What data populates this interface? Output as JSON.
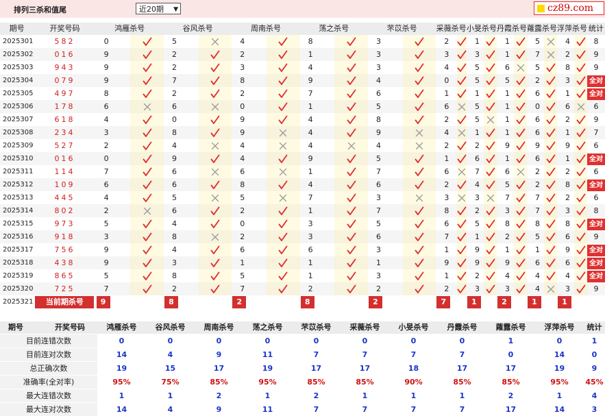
{
  "header": {
    "title": "排列三杀和值尾",
    "select_value": "近20期",
    "logo_text": "cz89.com"
  },
  "columns": {
    "period": "期号",
    "draw": "开奖号码",
    "experts": [
      "鸿雁杀号",
      "谷风杀号",
      "周南杀号",
      "荡之杀号",
      "芣苡杀号",
      "采薇杀号",
      "小旻杀号",
      "丹霞杀号",
      "蕹露杀号",
      "浮萍杀号"
    ],
    "stat": "统计"
  },
  "all_right_label": "全对",
  "current_label": "当前期杀号",
  "current_period": "2025321",
  "current_predictions": [
    "9",
    "8",
    "2",
    "8",
    "2",
    "7",
    "1",
    "2",
    "1",
    "1"
  ],
  "rows": [
    {
      "period": "2025301",
      "draw": "582",
      "kills": [
        "0",
        "5",
        "4",
        "8",
        "3",
        "2",
        "1",
        "1",
        "5",
        "4"
      ],
      "marks": [
        1,
        0,
        1,
        1,
        1,
        1,
        1,
        1,
        0,
        1
      ],
      "stat": "8"
    },
    {
      "period": "2025302",
      "draw": "016",
      "kills": [
        "9",
        "2",
        "2",
        "1",
        "3",
        "3",
        "3",
        "1",
        "7",
        "2"
      ],
      "marks": [
        1,
        1,
        1,
        1,
        1,
        1,
        1,
        1,
        0,
        1
      ],
      "stat": "9"
    },
    {
      "period": "2025303",
      "draw": "943",
      "kills": [
        "9",
        "2",
        "3",
        "4",
        "3",
        "4",
        "5",
        "6",
        "5",
        "8"
      ],
      "marks": [
        1,
        1,
        1,
        1,
        1,
        1,
        1,
        0,
        1,
        1
      ],
      "stat": "9"
    },
    {
      "period": "2025304",
      "draw": "079",
      "kills": [
        "9",
        "7",
        "8",
        "9",
        "4",
        "0",
        "5",
        "5",
        "2",
        "3"
      ],
      "marks": [
        1,
        1,
        1,
        1,
        1,
        1,
        1,
        1,
        1,
        1
      ],
      "stat": "全对"
    },
    {
      "period": "2025305",
      "draw": "497",
      "kills": [
        "8",
        "2",
        "2",
        "7",
        "6",
        "1",
        "1",
        "1",
        "6",
        "1"
      ],
      "marks": [
        1,
        1,
        1,
        1,
        1,
        1,
        1,
        1,
        1,
        1
      ],
      "stat": "全对"
    },
    {
      "period": "2025306",
      "draw": "178",
      "kills": [
        "6",
        "6",
        "0",
        "1",
        "5",
        "6",
        "5",
        "1",
        "0",
        "6"
      ],
      "marks": [
        0,
        0,
        1,
        1,
        1,
        0,
        1,
        1,
        1,
        0
      ],
      "stat": "6"
    },
    {
      "period": "2025307",
      "draw": "618",
      "kills": [
        "4",
        "0",
        "9",
        "4",
        "8",
        "2",
        "5",
        "1",
        "6",
        "2"
      ],
      "marks": [
        1,
        1,
        1,
        1,
        1,
        1,
        0,
        1,
        1,
        1
      ],
      "stat": "9"
    },
    {
      "period": "2025308",
      "draw": "234",
      "kills": [
        "3",
        "8",
        "9",
        "4",
        "9",
        "4",
        "1",
        "1",
        "6",
        "1"
      ],
      "marks": [
        1,
        1,
        0,
        1,
        0,
        0,
        1,
        1,
        1,
        1
      ],
      "stat": "7"
    },
    {
      "period": "2025309",
      "draw": "527",
      "kills": [
        "2",
        "4",
        "4",
        "4",
        "4",
        "2",
        "2",
        "9",
        "9",
        "9"
      ],
      "marks": [
        1,
        0,
        0,
        0,
        0,
        1,
        1,
        1,
        1,
        1
      ],
      "stat": "6"
    },
    {
      "period": "2025310",
      "draw": "016",
      "kills": [
        "0",
        "9",
        "4",
        "9",
        "5",
        "1",
        "6",
        "1",
        "6",
        "1"
      ],
      "marks": [
        1,
        1,
        1,
        1,
        1,
        1,
        1,
        1,
        1,
        1
      ],
      "stat": "全对"
    },
    {
      "period": "2025311",
      "draw": "114",
      "kills": [
        "7",
        "6",
        "6",
        "1",
        "7",
        "6",
        "7",
        "6",
        "2",
        "2"
      ],
      "marks": [
        1,
        0,
        0,
        1,
        1,
        0,
        1,
        0,
        1,
        1
      ],
      "stat": "6"
    },
    {
      "period": "2025312",
      "draw": "109",
      "kills": [
        "6",
        "6",
        "8",
        "4",
        "6",
        "2",
        "4",
        "5",
        "2",
        "8"
      ],
      "marks": [
        1,
        1,
        1,
        1,
        1,
        1,
        1,
        1,
        1,
        1
      ],
      "stat": "全对"
    },
    {
      "period": "2025313",
      "draw": "445",
      "kills": [
        "4",
        "5",
        "5",
        "7",
        "3",
        "3",
        "3",
        "7",
        "7",
        "2"
      ],
      "marks": [
        1,
        0,
        0,
        1,
        0,
        0,
        0,
        1,
        1,
        1
      ],
      "stat": "6"
    },
    {
      "period": "2025314",
      "draw": "802",
      "kills": [
        "2",
        "6",
        "2",
        "1",
        "7",
        "8",
        "2",
        "3",
        "7",
        "3"
      ],
      "marks": [
        0,
        1,
        1,
        1,
        1,
        1,
        1,
        1,
        1,
        1
      ],
      "stat": "8"
    },
    {
      "period": "2025315",
      "draw": "973",
      "kills": [
        "5",
        "4",
        "0",
        "3",
        "5",
        "6",
        "5",
        "8",
        "8",
        "8"
      ],
      "marks": [
        1,
        1,
        1,
        1,
        1,
        1,
        1,
        1,
        1,
        1
      ],
      "stat": "全对"
    },
    {
      "period": "2025316",
      "draw": "918",
      "kills": [
        "3",
        "8",
        "2",
        "3",
        "6",
        "7",
        "1",
        "2",
        "5",
        "6"
      ],
      "marks": [
        1,
        0,
        1,
        1,
        1,
        1,
        1,
        1,
        1,
        1
      ],
      "stat": "9"
    },
    {
      "period": "2025317",
      "draw": "756",
      "kills": [
        "9",
        "4",
        "6",
        "6",
        "3",
        "1",
        "9",
        "1",
        "1",
        "9"
      ],
      "marks": [
        1,
        1,
        1,
        1,
        1,
        1,
        1,
        1,
        1,
        1
      ],
      "stat": "全对"
    },
    {
      "period": "2025318",
      "draw": "438",
      "kills": [
        "9",
        "3",
        "1",
        "1",
        "1",
        "9",
        "9",
        "9",
        "6",
        "6"
      ],
      "marks": [
        1,
        1,
        1,
        1,
        1,
        1,
        1,
        1,
        1,
        1
      ],
      "stat": "全对"
    },
    {
      "period": "2025319",
      "draw": "865",
      "kills": [
        "5",
        "8",
        "5",
        "1",
        "3",
        "1",
        "2",
        "4",
        "4",
        "4"
      ],
      "marks": [
        1,
        1,
        1,
        1,
        1,
        1,
        1,
        1,
        1,
        1
      ],
      "stat": "全对"
    },
    {
      "period": "2025320",
      "draw": "725",
      "kills": [
        "7",
        "2",
        "7",
        "2",
        "2",
        "2",
        "3",
        "3",
        "4",
        "3"
      ],
      "marks": [
        1,
        1,
        1,
        1,
        1,
        1,
        1,
        1,
        0,
        1
      ],
      "stat": "9"
    }
  ],
  "summary": [
    {
      "label": "目前连错次数",
      "values": [
        "0",
        "0",
        "0",
        "0",
        "0",
        "0",
        "0",
        "0",
        "1",
        "0"
      ],
      "stat": "1",
      "color": "blue"
    },
    {
      "label": "目前连对次数",
      "values": [
        "14",
        "4",
        "9",
        "11",
        "7",
        "7",
        "7",
        "7",
        "0",
        "14"
      ],
      "stat": "0",
      "color": "blue"
    },
    {
      "label": "总正确次数",
      "values": [
        "19",
        "15",
        "17",
        "19",
        "17",
        "17",
        "18",
        "17",
        "17",
        "19"
      ],
      "stat": "9",
      "color": "blue"
    },
    {
      "label": "准确率(全对率)",
      "values": [
        "95%",
        "75%",
        "85%",
        "95%",
        "85%",
        "85%",
        "90%",
        "85%",
        "85%",
        "95%"
      ],
      "stat": "45%",
      "color": "red"
    },
    {
      "label": "最大连错次数",
      "values": [
        "1",
        "1",
        "2",
        "1",
        "2",
        "1",
        "1",
        "1",
        "2",
        "1"
      ],
      "stat": "4",
      "color": "blue"
    },
    {
      "label": "最大连对次数",
      "values": [
        "14",
        "4",
        "9",
        "11",
        "7",
        "7",
        "7",
        "7",
        "17",
        "14"
      ],
      "stat": "3",
      "color": "blue"
    }
  ],
  "colors": {
    "check": "#e03030",
    "cross": "#9a9a9a",
    "accent": "#d32f2f",
    "summary_blue": "#1a34c8"
  }
}
